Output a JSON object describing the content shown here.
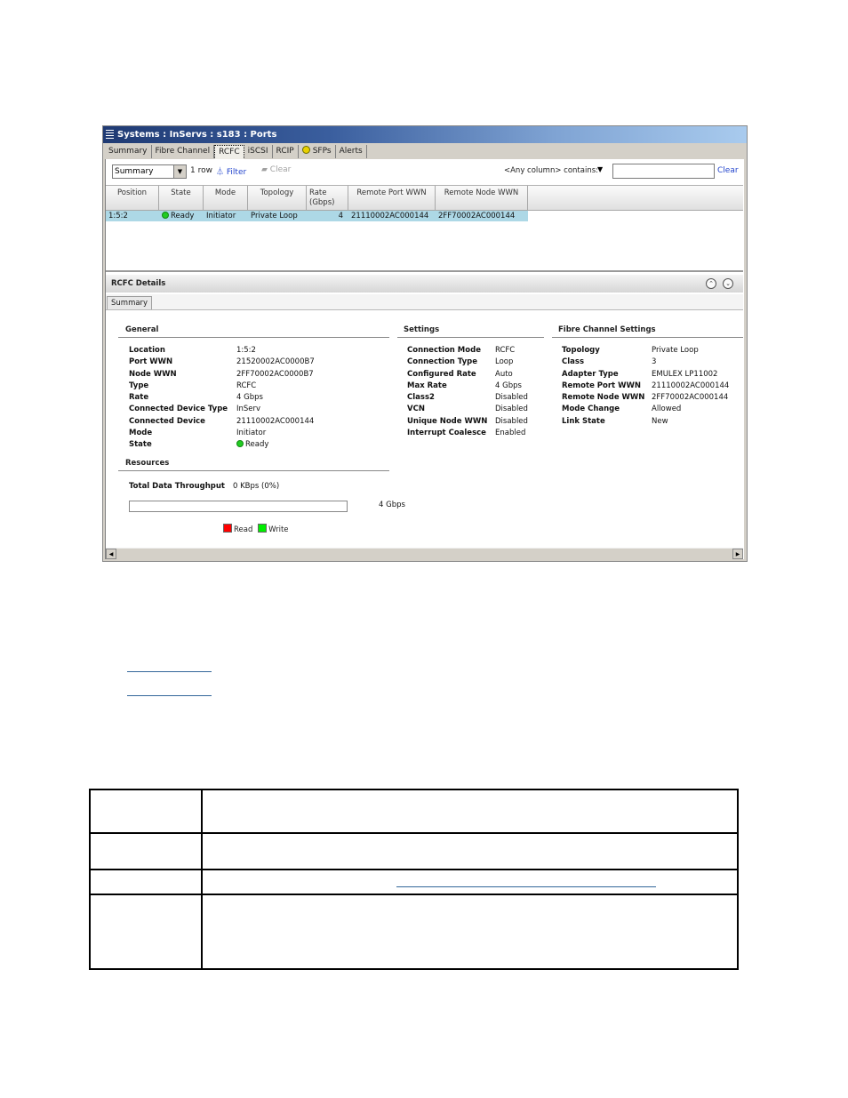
{
  "window": {
    "title": "Systems : InServs : s183 : Ports",
    "tabs": [
      {
        "label": "Summary",
        "active": false
      },
      {
        "label": "Fibre Channel",
        "active": false
      },
      {
        "label": "RCFC",
        "active": true
      },
      {
        "label": "iSCSI",
        "active": false
      },
      {
        "label": "RCIP",
        "active": false
      },
      {
        "label": "SFPs",
        "active": false,
        "icon": "sfp-status-icon"
      },
      {
        "label": "Alerts",
        "active": false
      }
    ]
  },
  "toolbar": {
    "view_select": "Summary",
    "row_count": "1 row",
    "filter_label": "Filter",
    "clear_label": "Clear",
    "column_filter": "<Any column> contains:",
    "search_value": "",
    "search_clear_label": "Clear"
  },
  "grid": {
    "columns": [
      "Position",
      "State",
      "Mode",
      "Topology",
      "Rate\n(Gbps)",
      "Remote Port WWN",
      "Remote Node WWN"
    ],
    "rows": [
      {
        "position": "1:5:2",
        "state": "Ready",
        "mode": "Initiator",
        "topology": "Private Loop",
        "rate": "4",
        "remote_port_wwn": "21110002AC000144",
        "remote_node_wwn": "2FF70002AC000144"
      }
    ]
  },
  "details": {
    "title": "RCFC Details",
    "tabs": [
      "Summary"
    ],
    "general": {
      "title": "General",
      "items": [
        {
          "k": "Location",
          "v": "1:5:2"
        },
        {
          "k": "Port WWN",
          "v": "21520002AC0000B7"
        },
        {
          "k": "Node WWN",
          "v": "2FF70002AC0000B7"
        },
        {
          "k": "Type",
          "v": "RCFC"
        },
        {
          "k": "Rate",
          "v": "4 Gbps"
        },
        {
          "k": "Connected Device Type",
          "v": "InServ"
        },
        {
          "k": "Connected Device",
          "v": "21110002AC000144"
        },
        {
          "k": "Mode",
          "v": "Initiator"
        },
        {
          "k": "State",
          "v": "Ready"
        }
      ]
    },
    "settings": {
      "title": "Settings",
      "items": [
        {
          "k": "Connection Mode",
          "v": "RCFC"
        },
        {
          "k": "Connection Type",
          "v": "Loop"
        },
        {
          "k": "Configured Rate",
          "v": "Auto"
        },
        {
          "k": "Max Rate",
          "v": "4 Gbps"
        },
        {
          "k": "Class2",
          "v": "Disabled"
        },
        {
          "k": "VCN",
          "v": "Disabled"
        },
        {
          "k": "Unique Node WWN",
          "v": "Disabled"
        },
        {
          "k": "Interrupt Coalesce",
          "v": "Enabled"
        }
      ]
    },
    "fibre_channel": {
      "title": "Fibre Channel Settings",
      "items": [
        {
          "k": "Topology",
          "v": "Private Loop"
        },
        {
          "k": "Class",
          "v": "3"
        },
        {
          "k": "Adapter Type",
          "v": "EMULEX LP11002"
        },
        {
          "k": "Remote Port WWN",
          "v": "21110002AC000144"
        },
        {
          "k": "Remote Node WWN",
          "v": "2FF70002AC000144"
        },
        {
          "k": "Mode Change",
          "v": "Allowed"
        },
        {
          "k": "Link State",
          "v": "New"
        }
      ]
    },
    "resources": {
      "title": "Resources",
      "throughput_label": "Total Data Throughput",
      "throughput_value": "0 KBps (0%)",
      "throughput_percent": 0,
      "max_label": "4 Gbps",
      "legend": [
        {
          "label": "Read",
          "color": "#ff0000"
        },
        {
          "label": "Write",
          "color": "#00ee00"
        }
      ]
    }
  },
  "colors": {
    "selected_row": "#add8e6",
    "ready_dot": "#22cc22",
    "link": "#2244cc"
  }
}
